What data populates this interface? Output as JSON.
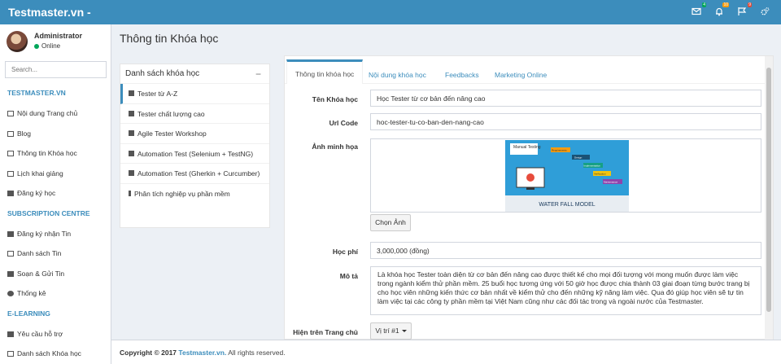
{
  "header": {
    "brand": "Testmaster.vn -",
    "icons": [
      {
        "name": "envelope-icon",
        "badge": "4",
        "badge_color": "#00a65a"
      },
      {
        "name": "bell-icon",
        "badge": "10",
        "badge_color": "#f39c12"
      },
      {
        "name": "flag-icon",
        "badge": "9",
        "badge_color": "#dd4b39"
      },
      {
        "name": "gears-icon",
        "badge": "",
        "badge_color": ""
      }
    ]
  },
  "sidebar": {
    "user_name": "Administrator",
    "user_status": "Online",
    "search_placeholder": "Search...",
    "sections": [
      {
        "header": "TESTMASTER.VN",
        "items": [
          "Nội dung Trang chủ",
          "Blog",
          "Thông tin Khóa học",
          "Lịch khai giảng",
          "Đăng ký học"
        ]
      },
      {
        "header": "SUBSCRIPTION CENTRE",
        "items": [
          "Đăng ký nhận Tin",
          "Danh sách Tin",
          "Soạn & Gửi Tin",
          "Thống kê"
        ]
      },
      {
        "header": "E-LEARNING",
        "items": [
          "Yêu cầu hỗ trợ",
          "Danh sách Khóa học"
        ]
      }
    ]
  },
  "main": {
    "page_title": "Thông tin Khóa học",
    "course_list": {
      "heading": "Danh sách khóa học",
      "items": [
        "Tester từ A-Z",
        "Tester chất lượng cao",
        "Agile Tester Workshop",
        "Automation Test (Selenium + TestNG)",
        "Automation Test (Gherkin + Curcumber)",
        "Phân tích nghiệp vụ phần mềm"
      ]
    },
    "tabs": [
      "Thông tin khóa học",
      "Nội dung khóa học",
      "Feedbacks",
      "Marketing Online"
    ],
    "form": {
      "name_label": "Tên Khóa học",
      "name_value": "Học Tester từ cơ bản đến nâng cao",
      "url_label": "Url Code",
      "url_value": "hoc-tester-tu-co-ban-den-nang-cao",
      "image_label": "Ảnh minh họa",
      "image": {
        "top_label": "Manual Testing",
        "caption": "WATER FALL MODEL",
        "steps": [
          "Requirements",
          "Design",
          "Implementation",
          "Verification",
          "Maintenance"
        ]
      },
      "choose_image_button": "Chọn Ảnh",
      "fee_label": "Học phí",
      "fee_value": "3,000,000 (đồng)",
      "desc_label": "Mô tả",
      "desc_value": "Là khóa học Tester toàn diện từ cơ bản đến nâng cao được thiết kế cho mọi đối tượng với mong muốn được làm việc trong ngành kiểm thử phần mềm. 25 buổi học tương ứng với 50 giờ học được chia thành 03 giai đoạn từng bước trang bị cho học viên những kiến thức cơ bản nhất về kiểm thử cho đến những kỹ năng làm việc. Qua đó giúp học viên sẽ tự tin làm việc tại các công ty phần mềm tại Việt Nam cũng như các đối tác trong và ngoài nước của Testmaster.",
      "show_label": "Hiện trên Trang chủ",
      "show_value": "Vị trí #1"
    }
  },
  "footer": {
    "copyright": "Copyright © 2017",
    "site": "Testmaster.vn.",
    "rights": "All rights reserved."
  },
  "colors": {
    "primary": "#3c8dbc",
    "online": "#00a65a"
  }
}
